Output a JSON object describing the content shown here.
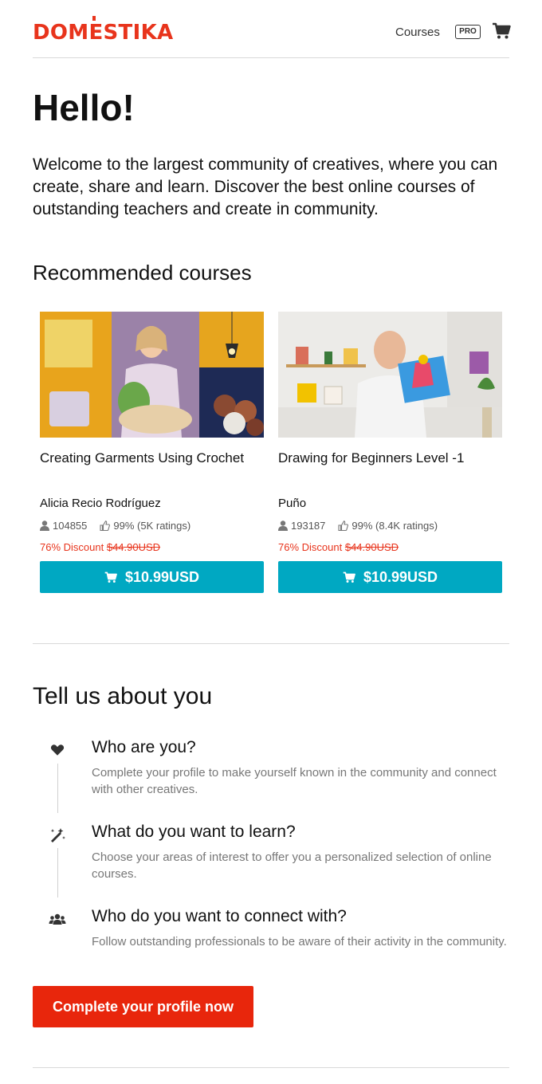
{
  "header": {
    "logo_text": "DOMESTIKA",
    "nav_courses": "Courses",
    "nav_pro": "PRO",
    "cart_icon": "cart-icon"
  },
  "hello": "Hello!",
  "intro": "Welcome to the largest community of creatives, where you can create, share and learn. Discover the best online courses of outstanding teachers and create in community.",
  "recommended": {
    "title": "Recommended courses",
    "courses": [
      {
        "title": "Creating Garments Using Crochet",
        "teacher": "Alicia Recio Rodríguez",
        "students": "104855",
        "rating": "99% (5K ratings)",
        "discount_label": "76% Discount",
        "old_price": "$44.90USD",
        "price": "$10.99USD"
      },
      {
        "title": "Drawing for Beginners Level -1",
        "teacher": "Puño",
        "students": "193187",
        "rating": "99% (8.4K ratings)",
        "discount_label": "76% Discount",
        "old_price": "$44.90USD",
        "price": "$10.99USD"
      }
    ]
  },
  "tell": {
    "title": "Tell us about you",
    "steps": [
      {
        "icon": "heart-icon",
        "title": "Who are you?",
        "desc": "Complete your profile to make yourself known in the community and connect with other creatives."
      },
      {
        "icon": "magic-wand-icon",
        "title": "What do you want to learn?",
        "desc": "Choose your areas of interest to offer you a personalized selection of online courses."
      },
      {
        "icon": "users-icon",
        "title": "Who do you want to connect with?",
        "desc": "Follow outstanding professionals to be aware of their activity in the community."
      }
    ],
    "cta": "Complete your profile now"
  },
  "colors": {
    "brand": "#e8341c",
    "buy_button": "#00a8c2",
    "cta_button": "#e8260c"
  }
}
